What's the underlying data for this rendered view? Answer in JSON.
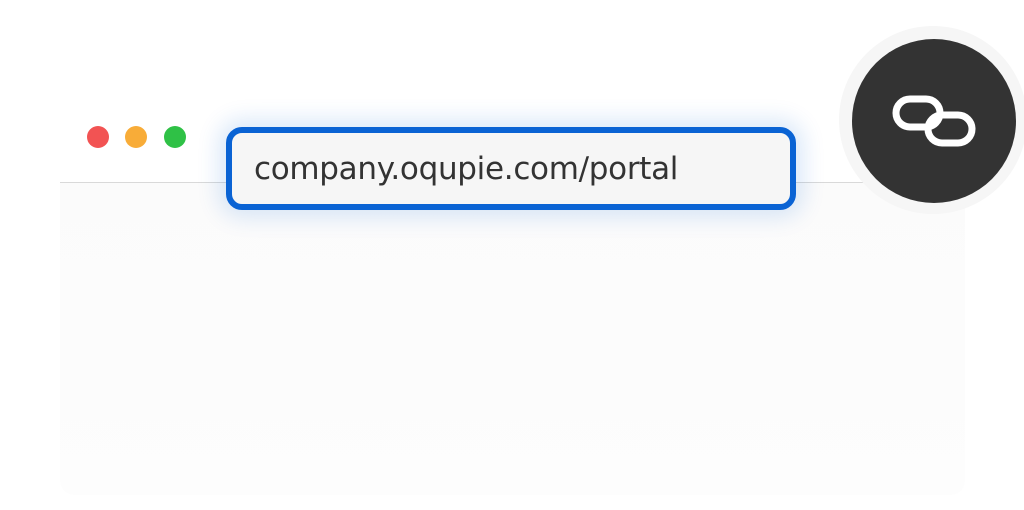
{
  "colors": {
    "close": "#f25353",
    "minimize": "#f8ac38",
    "maximize": "#2fc146",
    "accent": "#0a63d4",
    "badge": "#333333"
  },
  "window_controls": [
    "close",
    "minimize",
    "maximize"
  ],
  "address_bar": {
    "url": "company.oqupie.com/portal"
  },
  "link_badge": {
    "icon": "link-icon"
  }
}
